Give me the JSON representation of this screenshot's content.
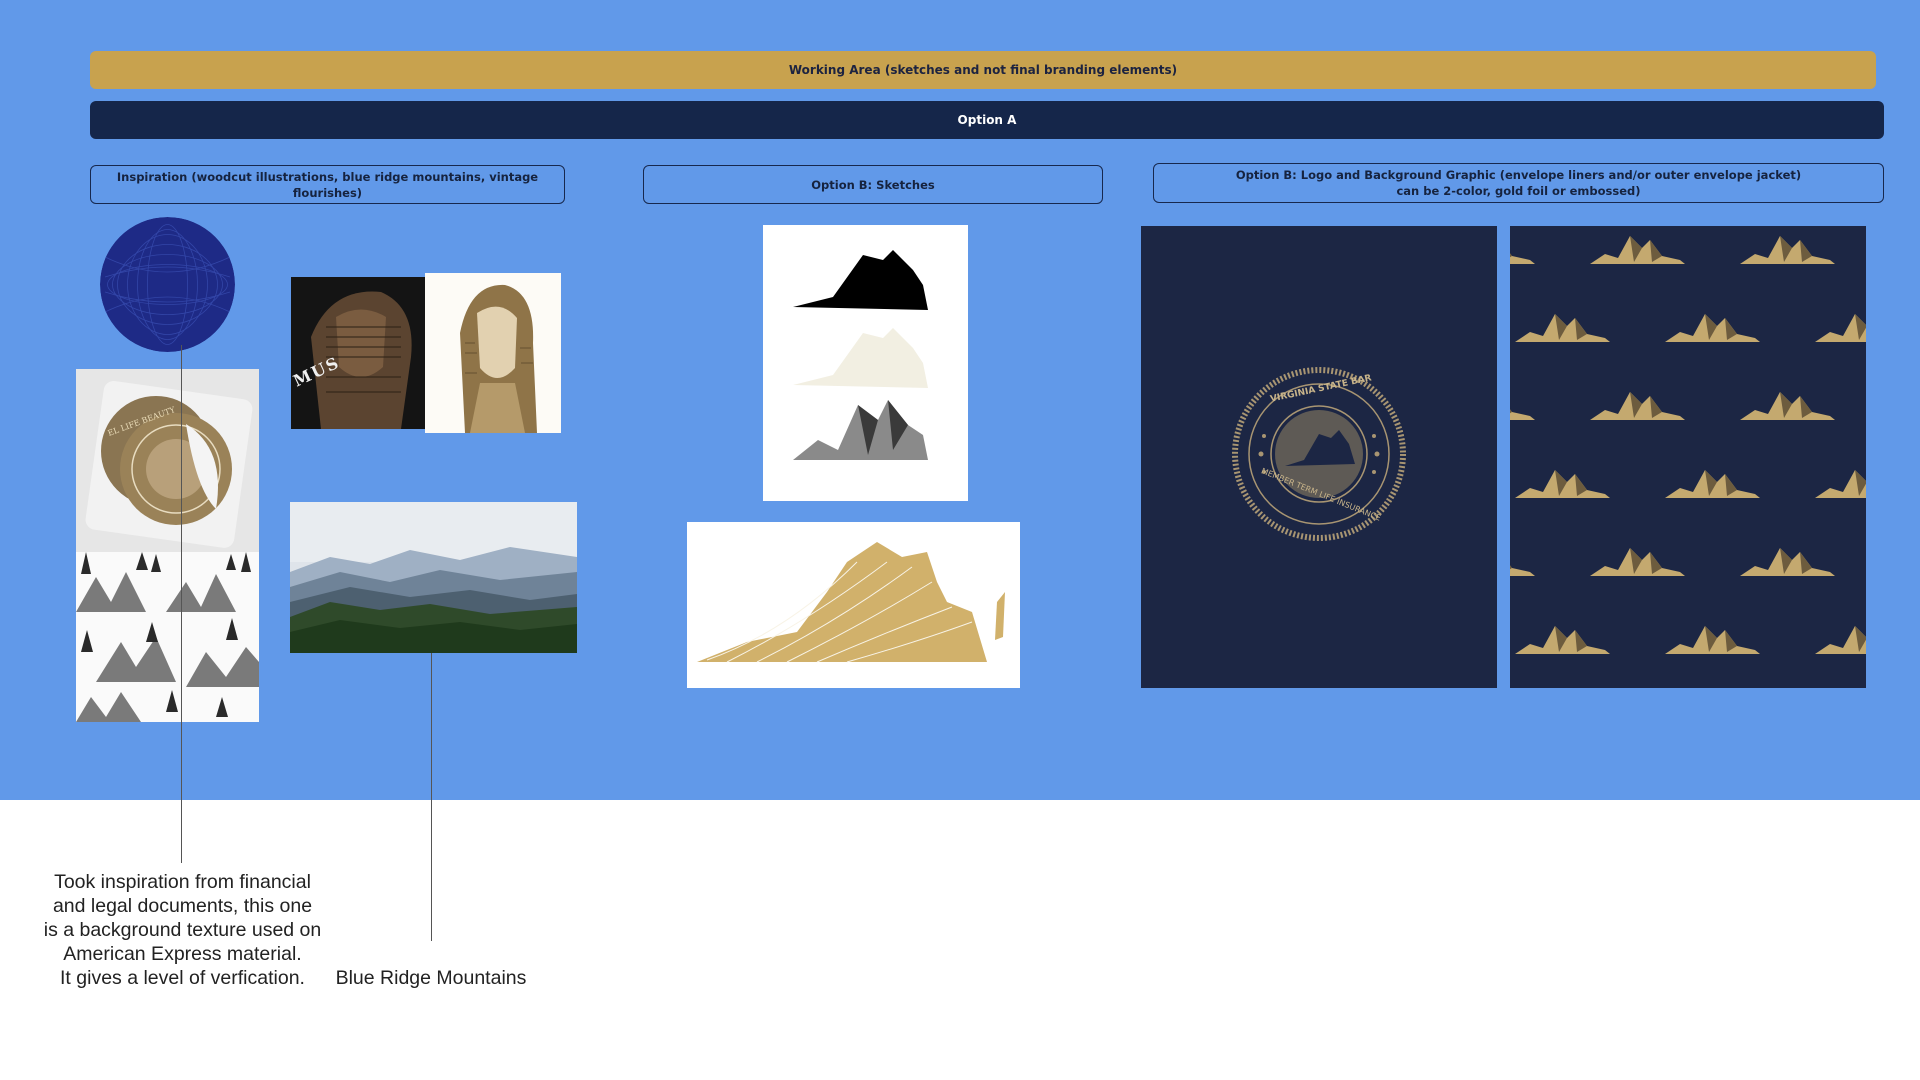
{
  "board": {
    "banner_working": "Working Area (sketches and not final branding elements)",
    "banner_option_a": "Option A",
    "sections": {
      "inspiration": "Inspiration (woodcut illustrations, blue ridge mountains, vintage flourishes)",
      "sketches": "Option B: Sketches",
      "logo_background": "Option B: Logo and Background Graphic (envelope liners and/or outer envelope jacket)\ncan be 2-color, gold foil or embossed)"
    },
    "image_text": {
      "card_text": "MUS",
      "seal_top": "VIRGINIA STATE BAR",
      "seal_bottom": "MEMBER TERM LIFE INSURANCE",
      "sticker_text": "EL LIFE BEAUTY"
    }
  },
  "notes": {
    "texture_note": "Took inspiration from financial\nand legal documents, this one\nis a background texture used on\nAmerican Express material.\nIt gives a level of verfication.",
    "mountains_note": "Blue Ridge Mountains"
  },
  "colors": {
    "board_blue": "#6199E9",
    "gold": "#C8A24E",
    "navy": "#15264A",
    "dark_navy": "#1C2644"
  }
}
